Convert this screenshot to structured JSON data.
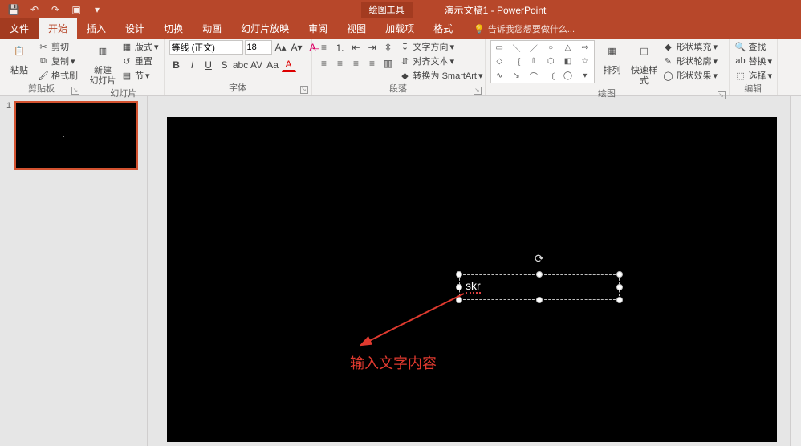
{
  "titlebar": {
    "contextual_tool_label": "绘图工具",
    "doc_title": "演示文稿1 - PowerPoint"
  },
  "tabs": {
    "file": "文件",
    "home": "开始",
    "insert": "插入",
    "design": "设计",
    "transitions": "切换",
    "animations": "动画",
    "slideshow": "幻灯片放映",
    "review": "审阅",
    "view": "视图",
    "addins": "加载项",
    "format": "格式",
    "tell_me_placeholder": "告诉我您想要做什么..."
  },
  "ribbon": {
    "clipboard": {
      "paste": "粘贴",
      "cut": "剪切",
      "copy": "复制",
      "format_painter": "格式刷",
      "group_label": "剪贴板"
    },
    "slides": {
      "new_slide": "新建\n幻灯片",
      "layout": "版式",
      "reset": "重置",
      "section": "节",
      "group_label": "幻灯片"
    },
    "font": {
      "name": "等线 (正文)",
      "size": "18",
      "group_label": "字体"
    },
    "paragraph": {
      "text_direction": "文字方向",
      "align_text": "对齐文本",
      "convert_smartart": "转换为 SmartArt",
      "group_label": "段落"
    },
    "drawing": {
      "arrange": "排列",
      "quick_styles": "快速样式",
      "shape_fill": "形状填充",
      "shape_outline": "形状轮廓",
      "shape_effects": "形状效果",
      "group_label": "绘图"
    },
    "editing": {
      "find": "查找",
      "replace": "替换",
      "select": "选择",
      "group_label": "编辑"
    }
  },
  "slide": {
    "thumb_number": "1",
    "textbox_content": "skr"
  },
  "annotation": {
    "label": "输入文字内容"
  },
  "colors": {
    "brand": "#b7472a",
    "annotation": "#e03a2f"
  }
}
